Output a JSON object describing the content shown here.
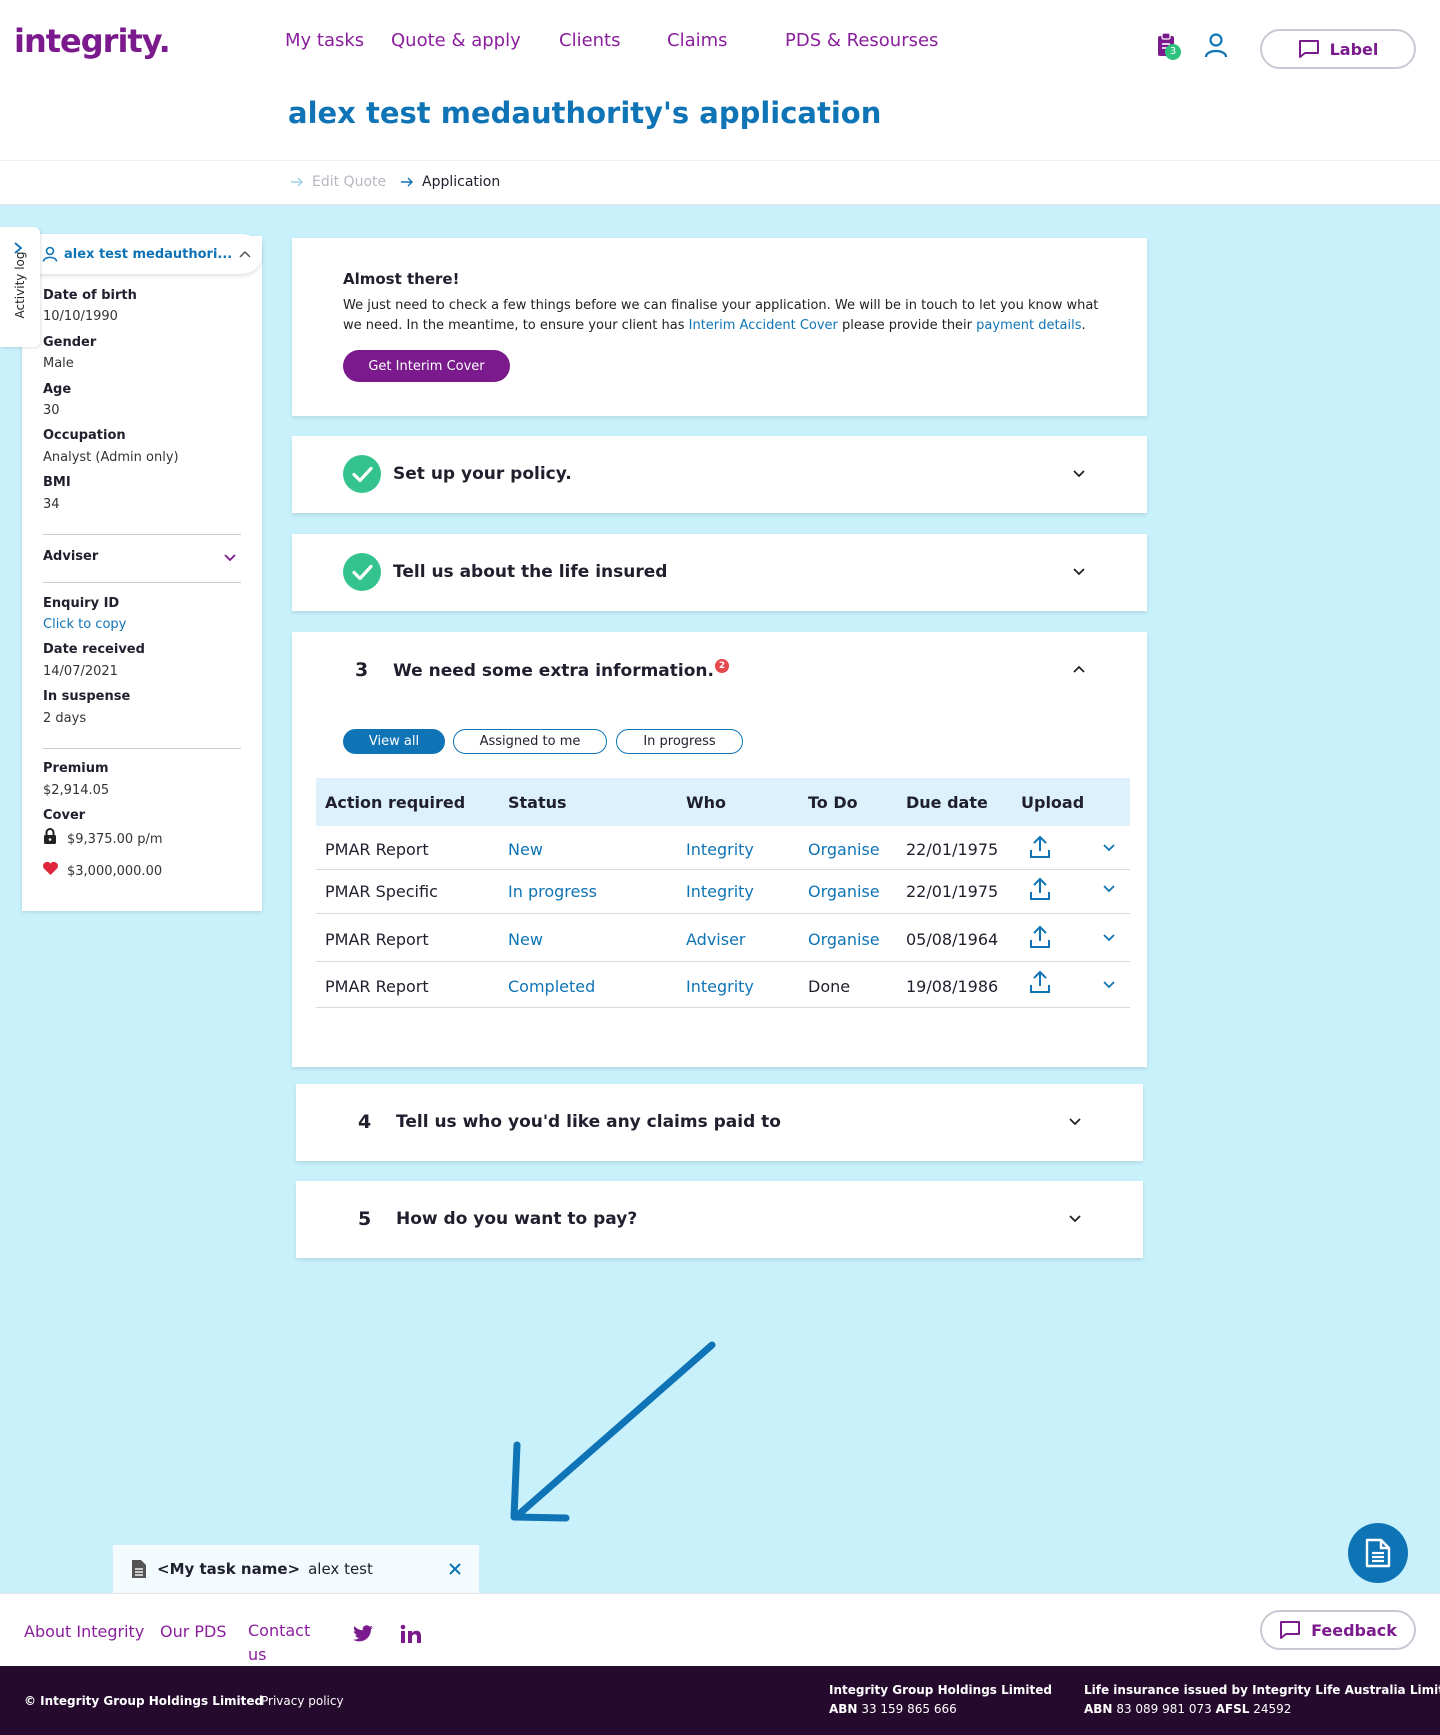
{
  "brand": {
    "logo": "integrity.",
    "purple": "#7b1a8c",
    "blue": "#0f74b5",
    "green": "#34c38f",
    "bg": "#c8f1fb"
  },
  "nav": {
    "items": [
      "My tasks",
      "Quote & apply",
      "Clients",
      "Claims",
      "PDS & Resourses"
    ]
  },
  "header": {
    "task_badge": "3",
    "label_button": "Label",
    "task_icon": "clipboard-icon",
    "user_icon": "user-icon"
  },
  "page": {
    "title": "alex test medauthority's application"
  },
  "breadcrumb": {
    "items": [
      "Edit Quote",
      "Application"
    ]
  },
  "sidebar": {
    "activity_log": "Activity log",
    "client_name": "alex test medauthori...",
    "fields": [
      {
        "label": "Date of birth",
        "value": "10/10/1990"
      },
      {
        "label": "Gender",
        "value": "Male"
      },
      {
        "label": "Age",
        "value": "30"
      },
      {
        "label": "Occupation",
        "value": "Analyst (Admin only)"
      },
      {
        "label": "BMI",
        "value": "34"
      }
    ],
    "adviser_label": "Adviser",
    "enquiry": [
      {
        "label": "Enquiry ID",
        "value": "Click to copy"
      },
      {
        "label": "Date received",
        "value": "14/07/2021"
      },
      {
        "label": "In suspense",
        "value": "2 days"
      }
    ],
    "premium_label": "Premium",
    "premium_value": "$2,914.05",
    "cover_label": "Cover",
    "cover_income": "$9,375.00 p/m",
    "cover_life": "$3,000,000.00"
  },
  "almost": {
    "title": "Almost there!",
    "text_1": "We just need to check a few things before we can finalise your application. We will be in touch to let you know what we need. In the meantime, to ensure your client has ",
    "link_1": "Interim Accident Cover",
    "text_2": " please provide their ",
    "link_2": "payment details",
    "text_3": ".",
    "button": "Get Interim Cover"
  },
  "steps": {
    "s1": {
      "title": "Set up your policy."
    },
    "s2": {
      "title": "Tell us about the life insured"
    },
    "s3": {
      "num": "3",
      "title": "We need some extra information.",
      "alert": "2"
    },
    "s4": {
      "num": "4",
      "title": "Tell us who you'd like any claims paid to"
    },
    "s5": {
      "num": "5",
      "title": "How do you want to pay?"
    }
  },
  "filters": [
    "View all",
    "Assigned to me",
    "In progress"
  ],
  "table": {
    "headers": [
      "Action required",
      "Status",
      "Who",
      "To Do",
      "Due date",
      "Upload"
    ],
    "rows": [
      {
        "action": "PMAR Report",
        "status": "New",
        "who": "Integrity",
        "todo": "Organise",
        "due": "22/01/1975"
      },
      {
        "action": "PMAR Specific",
        "status": "In progress",
        "who": "Integrity",
        "todo": "Organise",
        "due": "22/01/1975"
      },
      {
        "action": "PMAR Report",
        "status": "New",
        "who": "Adviser",
        "todo": "Organise",
        "due": "05/08/1964"
      },
      {
        "action": "PMAR Report",
        "status": "Completed",
        "who": "Integrity",
        "todo": "Done",
        "due": "19/08/1986"
      }
    ]
  },
  "toast": {
    "task_name": "<My task name>",
    "value": "alex test"
  },
  "footer": {
    "links": [
      "About Integrity",
      "Our PDS",
      "Contact us"
    ],
    "feedback": "Feedback",
    "copyright": "© Integrity Group Holdings Limited",
    "privacy": "Privacy policy",
    "company_1_name": "Integrity Group Holdings Limited",
    "company_1_abn_label": "ABN",
    "company_1_abn": "33 159 865 666",
    "company_2_name": "Life insurance issued by Integrity Life Australia Limited",
    "company_2_abn_label": "ABN",
    "company_2_abn": "83 089 981 073",
    "company_2_afsl_label": "AFSL",
    "company_2_afsl": "24592"
  }
}
